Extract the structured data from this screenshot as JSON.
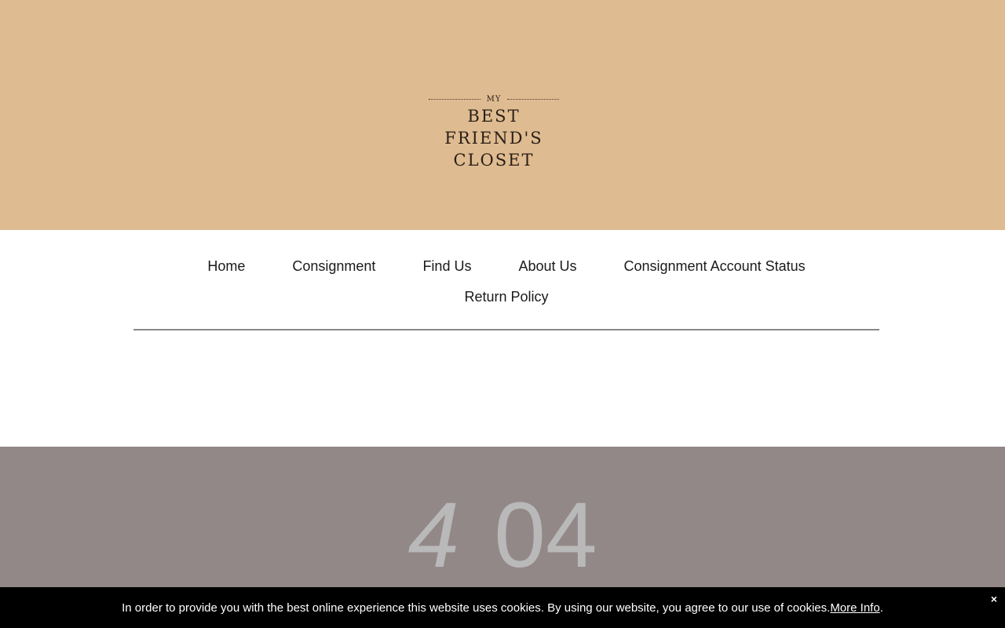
{
  "logo": {
    "top": "MY",
    "line1": "BEST FRIEND'S",
    "line2": "CLOSET"
  },
  "nav": {
    "items": [
      {
        "label": "Home"
      },
      {
        "label": "Consignment"
      },
      {
        "label": "Find Us"
      },
      {
        "label": "About Us"
      },
      {
        "label": "Consignment Account Status"
      },
      {
        "label": "Return Policy"
      }
    ]
  },
  "error": {
    "digit1": "4",
    "digits2": "04"
  },
  "cookie": {
    "message": "In order to provide you with the best online experience this website uses cookies. By using our website, you agree to our use of cookies. ",
    "link_label": "More Info",
    "suffix": ".",
    "close_label": "×"
  },
  "colors": {
    "header_bg": "#dfbb91",
    "error_bg": "#938888",
    "error_text": "#b9b9b9",
    "cookie_bg": "#000000"
  }
}
